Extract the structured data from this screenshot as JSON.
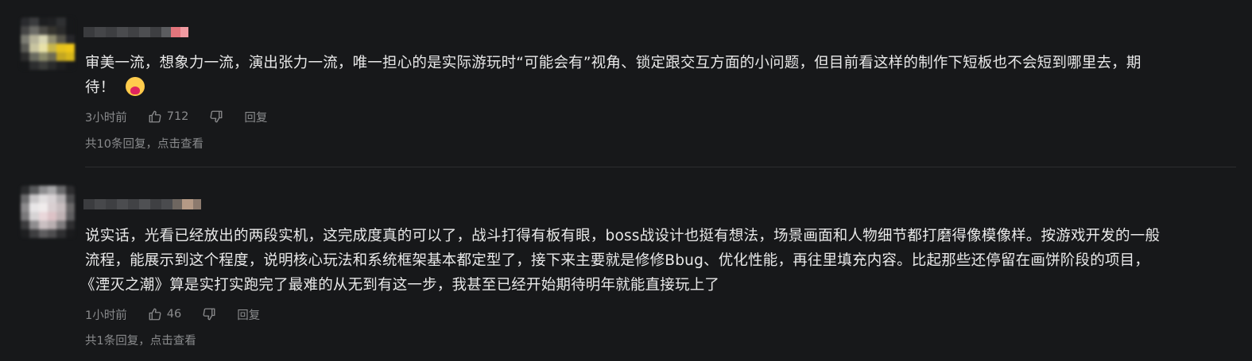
{
  "comments": [
    {
      "text_line1": "审美一流，想象力一流，演出张力一流，唯一担心的是实际游玩时“可能会有”视角、锁定跟交互方面的小问题，但目前看这样的制作下短板也不会短到哪里去，期",
      "text_line2": "待！",
      "emoji": "heart-face-emoji",
      "time": "3小时前",
      "likes": "712",
      "reply_label": "回复",
      "replies_summary": "共10条回复，点击查看"
    },
    {
      "text_line1": "说实话，光看已经放出的两段实机，这完成度真的可以了，战斗打得有板有眼，boss战设计也挺有想法，场景画面和人物细节都打磨得像模像样。按游戏开发的一般",
      "text_line2": "流程，能展示到这个程度，说明核心玩法和系统框架基本都定型了，接下来主要就是修修Bbug、优化性能，再往里填充内容。比起那些还停留在画饼阶段的项目，",
      "text_line3": "《湮灭之潮》算是实打实跑完了最难的从无到有这一步，我甚至已经开始期待明年就能直接玩上了",
      "time": "1小时前",
      "likes": "46",
      "reply_label": "回复",
      "replies_summary": "共1条回复，点击查看"
    }
  ],
  "icons": [
    "thumbs-up-icon",
    "thumbs-down-icon"
  ]
}
